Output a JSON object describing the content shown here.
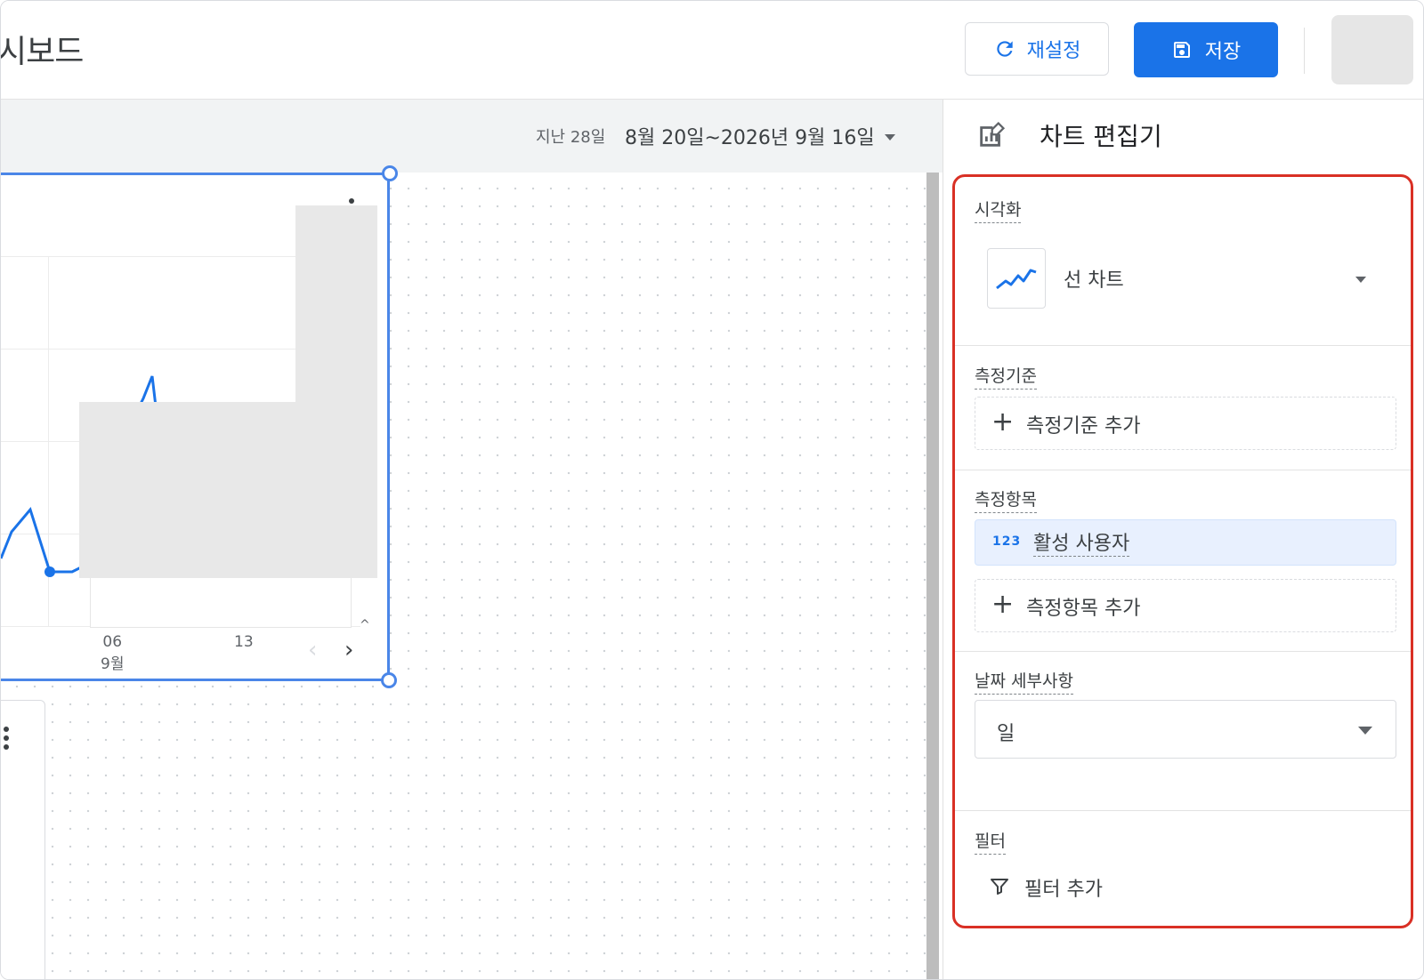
{
  "header": {
    "title": "시보드",
    "reset_label": "재설정",
    "save_label": "저장"
  },
  "date_bar": {
    "last_label": "지난 28일",
    "range_label": "8월 20일~2026년 9월 16일"
  },
  "chart": {
    "x_ticks": [
      {
        "top": "06",
        "bottom": "9월"
      },
      {
        "top": "13",
        "bottom": ""
      }
    ],
    "line_color": "#1a73e8"
  },
  "panel": {
    "title": "차트 편집기",
    "visualization": {
      "label": "시각화",
      "value": "선 차트",
      "icon": "line-chart-icon"
    },
    "dimension": {
      "label": "측정기준",
      "add_label": "측정기준 추가"
    },
    "metrics": {
      "label": "측정항목",
      "items": [
        {
          "badge": "123",
          "label": "활성 사용자"
        }
      ],
      "add_label": "측정항목 추가"
    },
    "date_granularity": {
      "label": "날짜 세부사항",
      "value": "일"
    },
    "filter": {
      "label": "필터",
      "add_label": "필터 추가"
    }
  },
  "colors": {
    "accent": "#1a73e8",
    "highlight": "#d93025"
  }
}
